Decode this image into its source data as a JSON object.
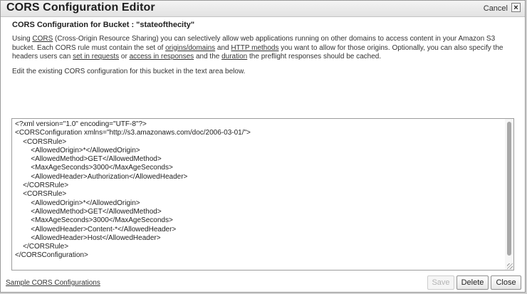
{
  "dialog": {
    "title": "CORS Configuration Editor",
    "cancel_label": "Cancel",
    "close_glyph": "×"
  },
  "bucket_heading": "CORS Configuration for Bucket : \"stateofthecity\"",
  "description": {
    "t1": "Using ",
    "link_cors": "CORS",
    "t2": " (Cross-Origin Resource Sharing) you can selectively allow web applications running on other domains to access content in your Amazon S3 bucket. Each CORS rule must contain the set of ",
    "link_origins": "origins/domains",
    "t3": " and ",
    "link_methods": "HTTP methods",
    "t4": " you want to allow for those origins. Optionally, you can also specify the headers users can ",
    "link_set_in_requests": "set in requests",
    "t5": " or ",
    "link_access_in_responses": "access in responses",
    "t6": " and the ",
    "link_duration": "duration",
    "t7": " the preflight responses should be cached."
  },
  "edit_note": "Edit the existing CORS configuration for this bucket in the text area below.",
  "editor": {
    "content": "<?xml version=\"1.0\" encoding=\"UTF-8\"?>\n<CORSConfiguration xmlns=\"http://s3.amazonaws.com/doc/2006-03-01/\">\n    <CORSRule>\n        <AllowedOrigin>*</AllowedOrigin>\n        <AllowedMethod>GET</AllowedMethod>\n        <MaxAgeSeconds>3000</MaxAgeSeconds>\n        <AllowedHeader>Authorization</AllowedHeader>\n    </CORSRule>\n    <CORSRule>\n        <AllowedOrigin>*</AllowedOrigin>\n        <AllowedMethod>GET</AllowedMethod>\n        <MaxAgeSeconds>3000</MaxAgeSeconds>\n        <AllowedHeader>Content-*</AllowedHeader>\n        <AllowedHeader>Host</AllowedHeader>\n    </CORSRule>\n</CORSConfiguration>"
  },
  "footer": {
    "sample_link": "Sample CORS Configurations",
    "save_label": "Save",
    "delete_label": "Delete",
    "close_label": "Close"
  },
  "icons": {
    "close": "close-icon"
  }
}
